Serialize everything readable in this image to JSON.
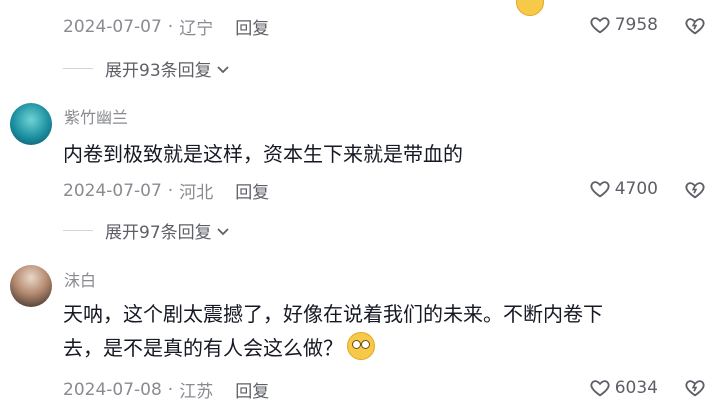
{
  "top": {
    "meta": {
      "date": "2024-07-07",
      "location": "辽宁",
      "reply_label": "回复",
      "likes": "7958"
    },
    "expand_label": "展开93条回复"
  },
  "comments": [
    {
      "author": "紫竹幽兰",
      "text": "内卷到极致就是这样，资本生下来就是带血的",
      "date": "2024-07-07",
      "location": "河北",
      "reply_label": "回复",
      "likes": "4700",
      "expand_label": "展开97条回复"
    },
    {
      "author": "沫白",
      "text_line1": "天呐，这个剧太震撼了，好像在说着我们的未来。不断内卷下",
      "text_line2": "去，是不是真的有人会这么做？",
      "date": "2024-07-08",
      "location": "江苏",
      "reply_label": "回复",
      "likes": "6034"
    }
  ],
  "icons": [
    "heart-icon",
    "dislike-heart-icon",
    "chevron-down-icon",
    "emoji-icon"
  ],
  "colors": {
    "text": "#161823",
    "meta": "#8a8b91",
    "secondary": "#5e5f66"
  }
}
